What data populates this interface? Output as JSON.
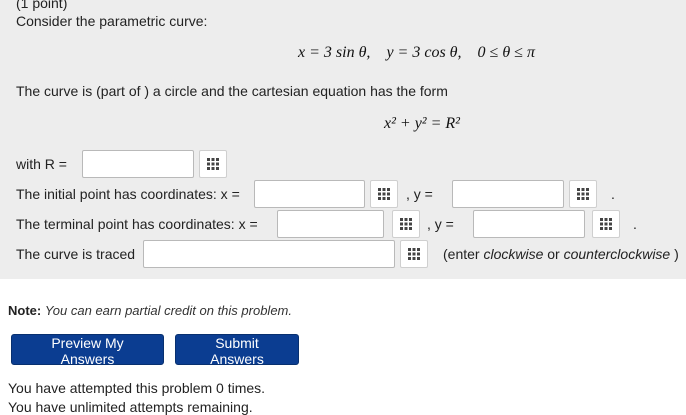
{
  "header": {
    "points": "(1 point)"
  },
  "intro": {
    "text": "Consider the parametric curve:"
  },
  "equation": {
    "x_part": "x = 3 sin θ,",
    "y_part": "y = 3 cos θ,",
    "range": "0 ≤ θ ≤ π"
  },
  "description": {
    "text": "The curve is (part of ) a circle and the cartesian equation has the form"
  },
  "cartesian": {
    "equation": "x² + y² = R²"
  },
  "rows": {
    "radius_label": "with R =",
    "initial_label": "The initial point has coordinates: x =",
    "terminal_label": "The terminal point has coordinates: x =",
    "traced_label": "The curve is traced",
    "y_label": ", y =",
    "period": ".",
    "traced_hint_open": "(enter ",
    "traced_hint_cw": "clockwise",
    "traced_hint_or": " or ",
    "traced_hint_ccw": "counterclockwise",
    "traced_hint_close": " )"
  },
  "inputs": {
    "radius": "",
    "initial_x": "",
    "initial_y": "",
    "terminal_x": "",
    "terminal_y": "",
    "traced": ""
  },
  "note": {
    "label": "Note:",
    "text": "You can earn partial credit on this problem."
  },
  "buttons": {
    "preview": "Preview My Answers",
    "submit": "Submit Answers"
  },
  "footer": {
    "attempts": "You have attempted this problem 0 times.",
    "unlimited": "You have unlimited attempts remaining."
  },
  "icons": {
    "equation_editor": "grid-icon"
  },
  "colors": {
    "panel": "#ededed",
    "button": "#0b3d91"
  }
}
